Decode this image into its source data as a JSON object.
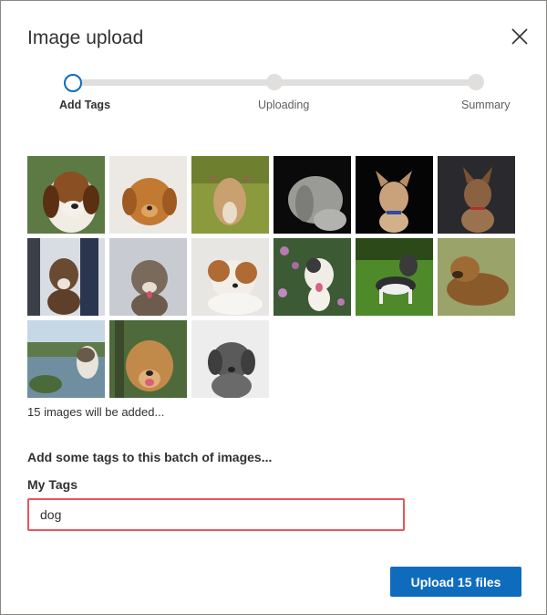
{
  "dialog": {
    "title": "Image upload",
    "close_icon": "close-icon"
  },
  "stepper": {
    "steps": [
      {
        "label": "Add Tags",
        "state": "active"
      },
      {
        "label": "Uploading",
        "state": "pending"
      },
      {
        "label": "Summary",
        "state": "pending"
      }
    ]
  },
  "images": [
    {
      "name": "beagle photo"
    },
    {
      "name": "golden puppy photo"
    },
    {
      "name": "greyhound photo"
    },
    {
      "name": "weimaraner photo"
    },
    {
      "name": "small terrier photo"
    },
    {
      "name": "brindle dog photo"
    },
    {
      "name": "boxer mix photo"
    },
    {
      "name": "pitbull photo"
    },
    {
      "name": "brown white dog photo"
    },
    {
      "name": "pitbull in flowers photo"
    },
    {
      "name": "husky photo"
    },
    {
      "name": "shepherd mix photo"
    },
    {
      "name": "husky by lake photo"
    },
    {
      "name": "golden retriever photo"
    },
    {
      "name": "grey dog photo"
    }
  ],
  "images_summary": "15 images will be added...",
  "tags": {
    "heading": "Add some tags to this batch of images...",
    "label": "My Tags",
    "value": "dog"
  },
  "actions": {
    "upload_label": "Upload 15 files"
  },
  "colors": {
    "accent": "#0f6cbd",
    "input_border": "#e8555b"
  }
}
